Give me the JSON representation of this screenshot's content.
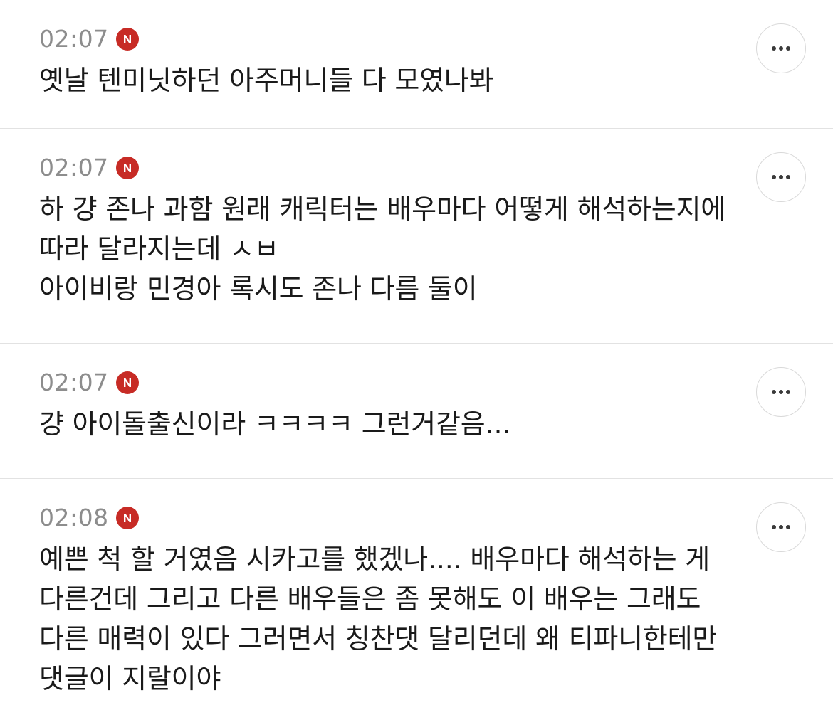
{
  "colors": {
    "badge": "#c72b25",
    "time": "#8d8d8d",
    "text": "#1a1a1a",
    "divider": "#e2e2e2"
  },
  "comments": [
    {
      "time": "02:07",
      "badge_icon": "n-badge-icon",
      "text": "옛날 텐미닛하던 아주머니들 다 모였나봐",
      "more_icon": "more-icon"
    },
    {
      "time": "02:07",
      "badge_icon": "n-badge-icon",
      "text": "하 걍 존나 과함 원래 캐릭터는 배우마다 어떻게 해석하는지에\n따라 달라지는데 ㅅㅂ\n아이비랑 민경아 록시도 존나 다름 둘이",
      "more_icon": "more-icon"
    },
    {
      "time": "02:07",
      "badge_icon": "n-badge-icon",
      "text": "걍 아이돌출신이라 ㅋㅋㅋㅋ 그런거같음...",
      "more_icon": "more-icon"
    },
    {
      "time": "02:08",
      "badge_icon": "n-badge-icon",
      "text": "예쁜 척 할 거였음 시카고를 했겠나.... 배우마다 해석하는 게\n다른건데 그리고 다른 배우들은 좀 못해도 이 배우는 그래도\n다른 매력이 있다 그러면서 칭찬댓 달리던데 왜 티파니한테만\n댓글이 지랄이야",
      "more_icon": "more-icon"
    }
  ]
}
